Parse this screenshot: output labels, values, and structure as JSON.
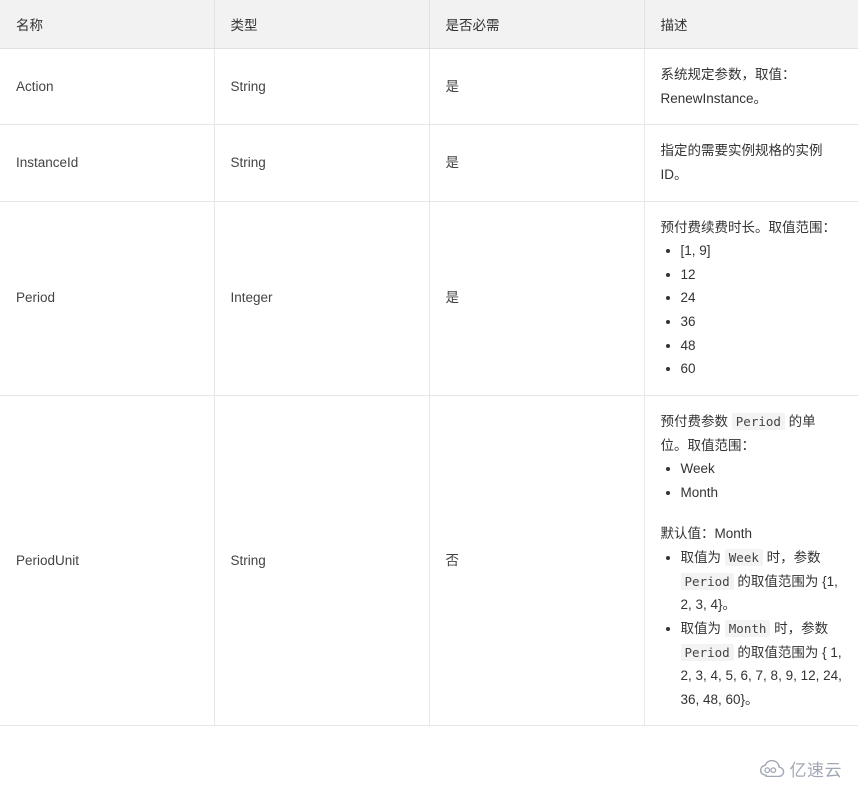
{
  "table": {
    "headers": [
      "名称",
      "类型",
      "是否必需",
      "描述"
    ],
    "rows": [
      {
        "name": "Action",
        "type": "String",
        "required": "是",
        "desc_lines": [
          "系统规定参数，取值：RenewInstance。"
        ]
      },
      {
        "name": "InstanceId",
        "type": "String",
        "required": "是",
        "desc_lines": [
          "指定的需要实例规格的实例ID。"
        ]
      },
      {
        "name": "Period",
        "type": "Integer",
        "required": "是",
        "desc_intro": "预付费续费时长。取值范围：",
        "desc_bullets": [
          "[1, 9]",
          "12",
          "24",
          "36",
          "48",
          "60"
        ]
      },
      {
        "name": "PeriodUnit",
        "type": "String",
        "required": "否",
        "desc_intro_a": "预付费参数 ",
        "desc_intro_code": "Period",
        "desc_intro_b": " 的单位。取值范围：",
        "desc_bullets": [
          "Week",
          "Month"
        ],
        "desc_default": "默认值：Month",
        "desc_rules": [
          {
            "a": "取值为 ",
            "code1": "Week",
            "b": " 时，参数 ",
            "code2": "Period",
            "c": " 的取值范围为 {1, 2, 3, 4}。"
          },
          {
            "a": "取值为 ",
            "code1": "Month",
            "b": " 时，参数 ",
            "code2": "Period",
            "c": " 的取值范围为 { 1, 2, 3, 4, 5, 6, 7, 8, 9, 12, 24, 36, 48, 60}。"
          }
        ]
      }
    ]
  },
  "watermark": {
    "text": "亿速云",
    "icon": "cloud-icon"
  },
  "colors": {
    "header_bg": "#f2f2f2",
    "border": "#e6e6e6",
    "text": "#333333",
    "code_bg": "#f3f3f3",
    "watermark": "#9aa0ad"
  }
}
